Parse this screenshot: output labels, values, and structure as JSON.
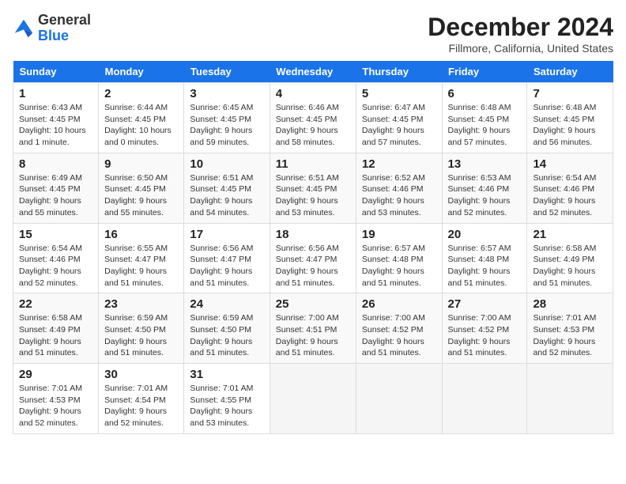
{
  "header": {
    "logo_line1": "General",
    "logo_line2": "Blue",
    "month_year": "December 2024",
    "location": "Fillmore, California, United States"
  },
  "days_of_week": [
    "Sunday",
    "Monday",
    "Tuesday",
    "Wednesday",
    "Thursday",
    "Friday",
    "Saturday"
  ],
  "weeks": [
    [
      {
        "num": "1",
        "sunrise": "6:43 AM",
        "sunset": "4:45 PM",
        "daylight": "10 hours and 1 minute."
      },
      {
        "num": "2",
        "sunrise": "6:44 AM",
        "sunset": "4:45 PM",
        "daylight": "10 hours and 0 minutes."
      },
      {
        "num": "3",
        "sunrise": "6:45 AM",
        "sunset": "4:45 PM",
        "daylight": "9 hours and 59 minutes."
      },
      {
        "num": "4",
        "sunrise": "6:46 AM",
        "sunset": "4:45 PM",
        "daylight": "9 hours and 58 minutes."
      },
      {
        "num": "5",
        "sunrise": "6:47 AM",
        "sunset": "4:45 PM",
        "daylight": "9 hours and 57 minutes."
      },
      {
        "num": "6",
        "sunrise": "6:48 AM",
        "sunset": "4:45 PM",
        "daylight": "9 hours and 57 minutes."
      },
      {
        "num": "7",
        "sunrise": "6:48 AM",
        "sunset": "4:45 PM",
        "daylight": "9 hours and 56 minutes."
      }
    ],
    [
      {
        "num": "8",
        "sunrise": "6:49 AM",
        "sunset": "4:45 PM",
        "daylight": "9 hours and 55 minutes."
      },
      {
        "num": "9",
        "sunrise": "6:50 AM",
        "sunset": "4:45 PM",
        "daylight": "9 hours and 55 minutes."
      },
      {
        "num": "10",
        "sunrise": "6:51 AM",
        "sunset": "4:45 PM",
        "daylight": "9 hours and 54 minutes."
      },
      {
        "num": "11",
        "sunrise": "6:51 AM",
        "sunset": "4:45 PM",
        "daylight": "9 hours and 53 minutes."
      },
      {
        "num": "12",
        "sunrise": "6:52 AM",
        "sunset": "4:46 PM",
        "daylight": "9 hours and 53 minutes."
      },
      {
        "num": "13",
        "sunrise": "6:53 AM",
        "sunset": "4:46 PM",
        "daylight": "9 hours and 52 minutes."
      },
      {
        "num": "14",
        "sunrise": "6:54 AM",
        "sunset": "4:46 PM",
        "daylight": "9 hours and 52 minutes."
      }
    ],
    [
      {
        "num": "15",
        "sunrise": "6:54 AM",
        "sunset": "4:46 PM",
        "daylight": "9 hours and 52 minutes."
      },
      {
        "num": "16",
        "sunrise": "6:55 AM",
        "sunset": "4:47 PM",
        "daylight": "9 hours and 51 minutes."
      },
      {
        "num": "17",
        "sunrise": "6:56 AM",
        "sunset": "4:47 PM",
        "daylight": "9 hours and 51 minutes."
      },
      {
        "num": "18",
        "sunrise": "6:56 AM",
        "sunset": "4:47 PM",
        "daylight": "9 hours and 51 minutes."
      },
      {
        "num": "19",
        "sunrise": "6:57 AM",
        "sunset": "4:48 PM",
        "daylight": "9 hours and 51 minutes."
      },
      {
        "num": "20",
        "sunrise": "6:57 AM",
        "sunset": "4:48 PM",
        "daylight": "9 hours and 51 minutes."
      },
      {
        "num": "21",
        "sunrise": "6:58 AM",
        "sunset": "4:49 PM",
        "daylight": "9 hours and 51 minutes."
      }
    ],
    [
      {
        "num": "22",
        "sunrise": "6:58 AM",
        "sunset": "4:49 PM",
        "daylight": "9 hours and 51 minutes."
      },
      {
        "num": "23",
        "sunrise": "6:59 AM",
        "sunset": "4:50 PM",
        "daylight": "9 hours and 51 minutes."
      },
      {
        "num": "24",
        "sunrise": "6:59 AM",
        "sunset": "4:50 PM",
        "daylight": "9 hours and 51 minutes."
      },
      {
        "num": "25",
        "sunrise": "7:00 AM",
        "sunset": "4:51 PM",
        "daylight": "9 hours and 51 minutes."
      },
      {
        "num": "26",
        "sunrise": "7:00 AM",
        "sunset": "4:52 PM",
        "daylight": "9 hours and 51 minutes."
      },
      {
        "num": "27",
        "sunrise": "7:00 AM",
        "sunset": "4:52 PM",
        "daylight": "9 hours and 51 minutes."
      },
      {
        "num": "28",
        "sunrise": "7:01 AM",
        "sunset": "4:53 PM",
        "daylight": "9 hours and 52 minutes."
      }
    ],
    [
      {
        "num": "29",
        "sunrise": "7:01 AM",
        "sunset": "4:53 PM",
        "daylight": "9 hours and 52 minutes."
      },
      {
        "num": "30",
        "sunrise": "7:01 AM",
        "sunset": "4:54 PM",
        "daylight": "9 hours and 52 minutes."
      },
      {
        "num": "31",
        "sunrise": "7:01 AM",
        "sunset": "4:55 PM",
        "daylight": "9 hours and 53 minutes."
      },
      null,
      null,
      null,
      null
    ]
  ]
}
